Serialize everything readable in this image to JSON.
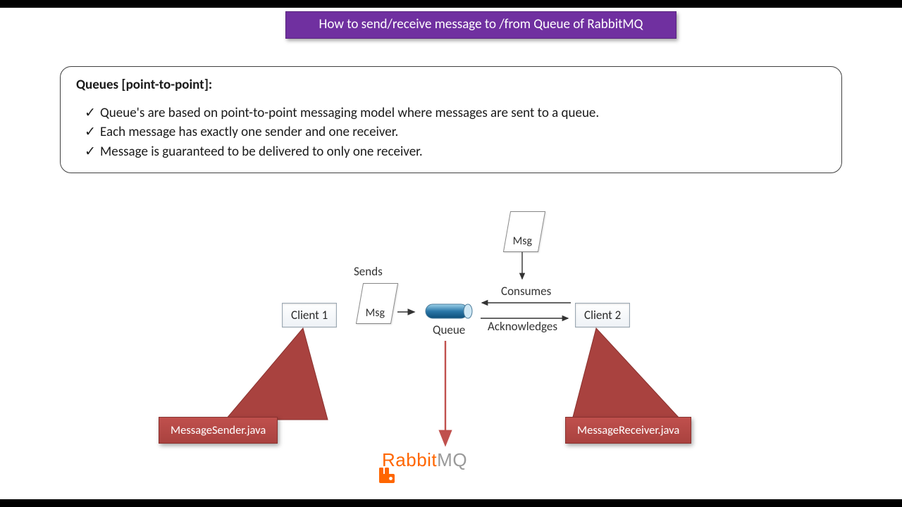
{
  "title": "How to send/receive message to /from Queue of RabbitMQ",
  "panel": {
    "heading": "Queues [point-to-point]:",
    "bullets": [
      "Queue's are based on point-to-point messaging model where messages are sent to a queue.",
      "Each message has exactly one sender and one receiver.",
      "Message is guaranteed to be delivered to only one receiver."
    ]
  },
  "diagram": {
    "client1": "Client 1",
    "client2": "Client 2",
    "msg": "Msg",
    "sends": "Sends",
    "consumes": "Consumes",
    "acknowledges": "Acknowledges",
    "queue": "Queue",
    "callout_sender": "MessageSender.java",
    "callout_receiver": "MessageReceiver.java",
    "logo_rabbit": "Rabbit",
    "logo_mq": "MQ"
  },
  "colors": {
    "title_bg": "#7030a0",
    "callout_bg": "#a9423f",
    "rabbit_orange": "#ff6600",
    "rabbit_grey": "#9a9a9a"
  }
}
